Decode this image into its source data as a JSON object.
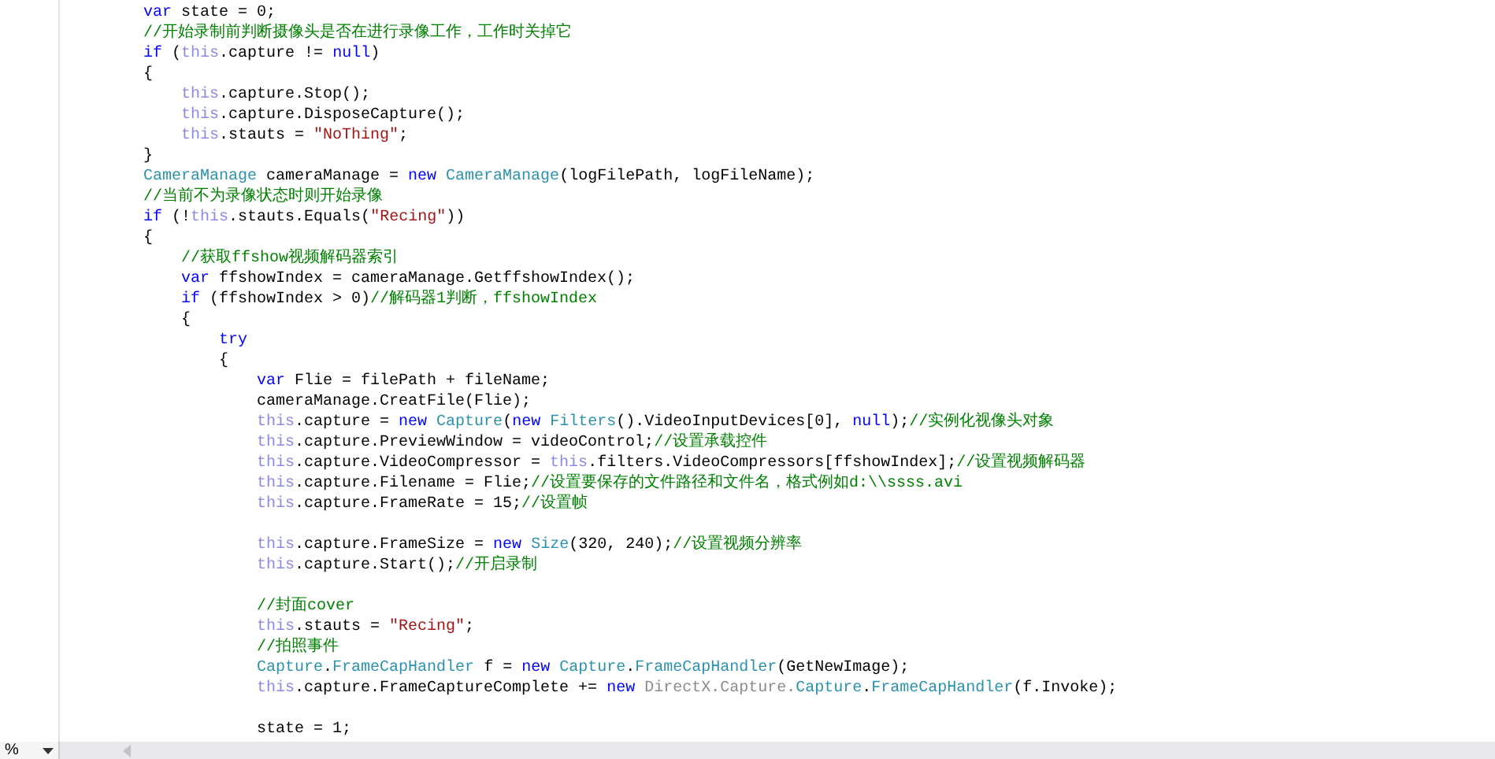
{
  "editor": {
    "lines": [
      {
        "kind": "code",
        "tokens": [
          {
            "kind": "keyword",
            "text": "var"
          },
          {
            "kind": "plain",
            "text": " state = 0;"
          }
        ]
      },
      {
        "kind": "code",
        "tokens": [
          {
            "kind": "comment",
            "text": "//开始录制前判断摄像头是否在进行录像工作，工作时关掉它"
          }
        ]
      },
      {
        "kind": "code",
        "tokens": [
          {
            "kind": "keyword",
            "text": "if"
          },
          {
            "kind": "plain",
            "text": " ("
          },
          {
            "kind": "this",
            "text": "this"
          },
          {
            "kind": "plain",
            "text": ".capture != "
          },
          {
            "kind": "keyword",
            "text": "null"
          },
          {
            "kind": "plain",
            "text": ")"
          }
        ]
      },
      {
        "kind": "code",
        "tokens": [
          {
            "kind": "plain",
            "text": "{"
          }
        ]
      },
      {
        "kind": "code",
        "tokens": [
          {
            "kind": "this",
            "text": "    this"
          },
          {
            "kind": "plain",
            "text": ".capture.Stop();"
          }
        ]
      },
      {
        "kind": "code",
        "tokens": [
          {
            "kind": "this",
            "text": "    this"
          },
          {
            "kind": "plain",
            "text": ".capture.DisposeCapture();"
          }
        ]
      },
      {
        "kind": "code",
        "tokens": [
          {
            "kind": "this",
            "text": "    this"
          },
          {
            "kind": "plain",
            "text": ".stauts = "
          },
          {
            "kind": "string",
            "text": "\"NoThing\""
          },
          {
            "kind": "plain",
            "text": ";"
          }
        ]
      },
      {
        "kind": "code",
        "tokens": [
          {
            "kind": "plain",
            "text": "}"
          }
        ]
      },
      {
        "kind": "code",
        "tokens": [
          {
            "kind": "type",
            "text": "CameraManage"
          },
          {
            "kind": "plain",
            "text": " cameraManage = "
          },
          {
            "kind": "keyword",
            "text": "new "
          },
          {
            "kind": "type",
            "text": "CameraManage"
          },
          {
            "kind": "plain",
            "text": "(logFilePath, logFileName);"
          }
        ]
      },
      {
        "kind": "code",
        "tokens": [
          {
            "kind": "comment",
            "text": "//当前不为录像状态时则开始录像"
          }
        ]
      },
      {
        "kind": "code",
        "tokens": [
          {
            "kind": "keyword",
            "text": "if"
          },
          {
            "kind": "plain",
            "text": " (!"
          },
          {
            "kind": "this",
            "text": "this"
          },
          {
            "kind": "plain",
            "text": ".stauts.Equals("
          },
          {
            "kind": "string",
            "text": "\"Recing\""
          },
          {
            "kind": "plain",
            "text": "))"
          }
        ]
      },
      {
        "kind": "code",
        "tokens": [
          {
            "kind": "plain",
            "text": "{"
          }
        ]
      },
      {
        "kind": "code",
        "tokens": [
          {
            "kind": "comment",
            "text": "    //获取ffshow视频解码器索引"
          }
        ]
      },
      {
        "kind": "code",
        "tokens": [
          {
            "kind": "keyword",
            "text": "    var"
          },
          {
            "kind": "plain",
            "text": " ffshowIndex = cameraManage.GetffshowIndex();"
          }
        ]
      },
      {
        "kind": "code",
        "tokens": [
          {
            "kind": "keyword",
            "text": "    if"
          },
          {
            "kind": "plain",
            "text": " (ffshowIndex > 0)"
          },
          {
            "kind": "comment",
            "text": "//解码器1判断，ffshowIndex"
          }
        ]
      },
      {
        "kind": "code",
        "tokens": [
          {
            "kind": "plain",
            "text": "    {"
          }
        ]
      },
      {
        "kind": "code",
        "tokens": [
          {
            "kind": "keyword",
            "text": "        try"
          }
        ]
      },
      {
        "kind": "code",
        "tokens": [
          {
            "kind": "plain",
            "text": "        {"
          }
        ]
      },
      {
        "kind": "code",
        "tokens": [
          {
            "kind": "keyword",
            "text": "            var"
          },
          {
            "kind": "plain",
            "text": " Flie = filePath + fileName;"
          }
        ]
      },
      {
        "kind": "code",
        "tokens": [
          {
            "kind": "plain",
            "text": "            cameraManage.CreatFile(Flie);"
          }
        ]
      },
      {
        "kind": "code",
        "tokens": [
          {
            "kind": "this",
            "text": "            this"
          },
          {
            "kind": "plain",
            "text": ".capture = "
          },
          {
            "kind": "keyword",
            "text": "new "
          },
          {
            "kind": "type",
            "text": "Capture"
          },
          {
            "kind": "plain",
            "text": "("
          },
          {
            "kind": "keyword",
            "text": "new "
          },
          {
            "kind": "type",
            "text": "Filters"
          },
          {
            "kind": "plain",
            "text": "().VideoInputDevices[0], "
          },
          {
            "kind": "keyword",
            "text": "null"
          },
          {
            "kind": "plain",
            "text": ");"
          },
          {
            "kind": "comment",
            "text": "//实例化视像头对象"
          }
        ]
      },
      {
        "kind": "code",
        "tokens": [
          {
            "kind": "this",
            "text": "            this"
          },
          {
            "kind": "plain",
            "text": ".capture.PreviewWindow = videoControl;"
          },
          {
            "kind": "comment",
            "text": "//设置承载控件"
          }
        ]
      },
      {
        "kind": "code",
        "tokens": [
          {
            "kind": "this",
            "text": "            this"
          },
          {
            "kind": "plain",
            "text": ".capture.VideoCompressor = "
          },
          {
            "kind": "this",
            "text": "this"
          },
          {
            "kind": "plain",
            "text": ".filters.VideoCompressors[ffshowIndex];"
          },
          {
            "kind": "comment",
            "text": "//设置视频解码器"
          }
        ]
      },
      {
        "kind": "code",
        "tokens": [
          {
            "kind": "this",
            "text": "            this"
          },
          {
            "kind": "plain",
            "text": ".capture.Filename = Flie;"
          },
          {
            "kind": "comment",
            "text": "//设置要保存的文件路径和文件名，格式例如d:\\\\ssss.avi"
          }
        ]
      },
      {
        "kind": "code",
        "tokens": [
          {
            "kind": "this",
            "text": "            this"
          },
          {
            "kind": "plain",
            "text": ".capture.FrameRate = 15;"
          },
          {
            "kind": "comment",
            "text": "//设置帧"
          }
        ]
      },
      {
        "kind": "blank"
      },
      {
        "kind": "code",
        "tokens": [
          {
            "kind": "this",
            "text": "            this"
          },
          {
            "kind": "plain",
            "text": ".capture.FrameSize = "
          },
          {
            "kind": "keyword",
            "text": "new "
          },
          {
            "kind": "type",
            "text": "Size"
          },
          {
            "kind": "plain",
            "text": "(320, 240);"
          },
          {
            "kind": "comment",
            "text": "//设置视频分辨率"
          }
        ]
      },
      {
        "kind": "code",
        "tokens": [
          {
            "kind": "this",
            "text": "            this"
          },
          {
            "kind": "plain",
            "text": ".capture.Start();"
          },
          {
            "kind": "comment",
            "text": "//开启录制"
          }
        ]
      },
      {
        "kind": "blank"
      },
      {
        "kind": "code",
        "tokens": [
          {
            "kind": "comment",
            "text": "            //封面cover"
          }
        ]
      },
      {
        "kind": "code",
        "tokens": [
          {
            "kind": "this",
            "text": "            this"
          },
          {
            "kind": "plain",
            "text": ".stauts = "
          },
          {
            "kind": "string",
            "text": "\"Recing\""
          },
          {
            "kind": "plain",
            "text": ";"
          }
        ]
      },
      {
        "kind": "code",
        "tokens": [
          {
            "kind": "comment",
            "text": "            //拍照事件"
          }
        ]
      },
      {
        "kind": "code",
        "tokens": [
          {
            "kind": "type",
            "text": "            Capture"
          },
          {
            "kind": "plain",
            "text": "."
          },
          {
            "kind": "type",
            "text": "FrameCapHandler"
          },
          {
            "kind": "plain",
            "text": " f = "
          },
          {
            "kind": "keyword",
            "text": "new "
          },
          {
            "kind": "type",
            "text": "Capture"
          },
          {
            "kind": "plain",
            "text": "."
          },
          {
            "kind": "type",
            "text": "FrameCapHandler"
          },
          {
            "kind": "plain",
            "text": "(GetNewImage);"
          }
        ]
      },
      {
        "kind": "code",
        "tokens": [
          {
            "kind": "this",
            "text": "            this"
          },
          {
            "kind": "plain",
            "text": ".capture.FrameCaptureComplete += "
          },
          {
            "kind": "keyword",
            "text": "new "
          },
          {
            "kind": "namespace",
            "text": "DirectX.Capture."
          },
          {
            "kind": "type",
            "text": "Capture"
          },
          {
            "kind": "plain",
            "text": "."
          },
          {
            "kind": "type",
            "text": "FrameCapHandler"
          },
          {
            "kind": "plain",
            "text": "(f.Invoke);"
          }
        ]
      },
      {
        "kind": "blank"
      },
      {
        "kind": "code",
        "tokens": [
          {
            "kind": "plain",
            "text": "            state = 1;"
          }
        ]
      }
    ]
  },
  "status_bar": {
    "zoom": "%"
  }
}
